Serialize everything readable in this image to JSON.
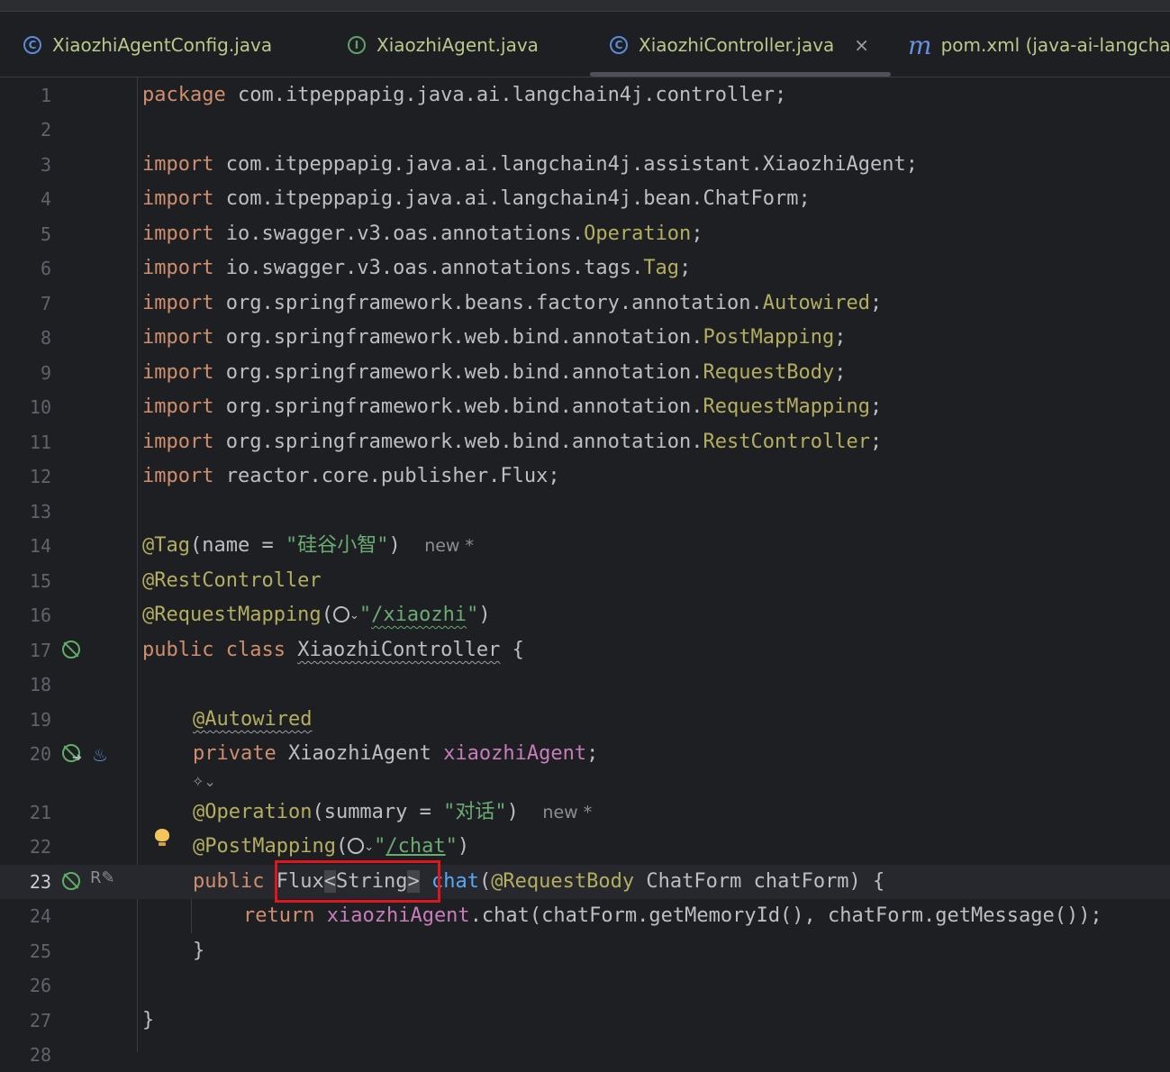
{
  "tabs": [
    {
      "icon": "class-icon",
      "label": "XiaozhiAgentConfig.java"
    },
    {
      "icon": "interface-icon",
      "label": "XiaozhiAgent.java"
    },
    {
      "icon": "class-icon",
      "label": "XiaozhiController.java",
      "active": true,
      "close": "×"
    },
    {
      "icon": "maven-icon",
      "label": "pom.xml (java-ai-langcha"
    }
  ],
  "gutter": {
    "line_numbers": [
      "1",
      "2",
      "3",
      "4",
      "5",
      "6",
      "7",
      "8",
      "9",
      "10",
      "11",
      "12",
      "13",
      "14",
      "15",
      "16",
      "17",
      "18",
      "19",
      "20",
      "21",
      "22",
      "23",
      "24",
      "25",
      "26",
      "27",
      "28"
    ],
    "current_line": "23"
  },
  "code": {
    "l1": {
      "kw": "package",
      "rest": " com.itpeppapig.java.ai.langchain4j.controller;"
    },
    "l3": {
      "kw": "import",
      "rest": " com.itpeppapig.java.ai.langchain4j.assistant.XiaozhiAgent;"
    },
    "l4": {
      "kw": "import",
      "rest": " com.itpeppapig.java.ai.langchain4j.bean.ChatForm;"
    },
    "l5": {
      "kw": "import",
      "pre": " io.swagger.v3.oas.annotations.",
      "ann": "Operation",
      "end": ";"
    },
    "l6": {
      "kw": "import",
      "pre": " io.swagger.v3.oas.annotations.tags.",
      "ann": "Tag",
      "end": ";"
    },
    "l7": {
      "kw": "import",
      "pre": " org.springframework.beans.factory.annotation.",
      "ann": "Autowired",
      "end": ";"
    },
    "l8": {
      "kw": "import",
      "pre": " org.springframework.web.bind.annotation.",
      "ann": "PostMapping",
      "end": ";"
    },
    "l9": {
      "kw": "import",
      "pre": " org.springframework.web.bind.annotation.",
      "ann": "RequestBody",
      "end": ";"
    },
    "l10": {
      "kw": "import",
      "pre": " org.springframework.web.bind.annotation.",
      "ann": "RequestMapping",
      "end": ";"
    },
    "l11": {
      "kw": "import",
      "pre": " org.springframework.web.bind.annotation.",
      "ann": "RestController",
      "end": ";"
    },
    "l12": {
      "kw": "import",
      "rest": " reactor.core.publisher.Flux;"
    },
    "l14": {
      "ann": "@Tag",
      "mid": "(name = ",
      "str": "\"硅谷小智\"",
      "end": ")",
      "hint": "new *"
    },
    "l15": {
      "ann": "@RestController"
    },
    "l16": {
      "ann": "@RequestMapping",
      "open": "(",
      "q1": "\"",
      "path": "/xiaozhi",
      "q2": "\"",
      "close": ")"
    },
    "l17": {
      "kw1": "public",
      "kw2": "class",
      "name": "XiaozhiController",
      "end": " {"
    },
    "l19": {
      "ann": "@Autowired"
    },
    "l20": {
      "kw": "private",
      "type": " XiaozhiAgent ",
      "field": "xiaozhiAgent",
      "end": ";"
    },
    "l21": {
      "ann": "@Operation",
      "mid": "(summary = ",
      "str": "\"对话\"",
      "end": ")",
      "hint": "new *"
    },
    "l22": {
      "ann": "@PostMapping",
      "open": "(",
      "q1": "\"",
      "path": "/chat",
      "q2": "\"",
      "close": ")"
    },
    "l23": {
      "kw": "public",
      "type": "Flux",
      "lt": "<",
      "inner": "String",
      "gt": ">",
      "fn": "chat",
      "p1": "(",
      "ann": "@RequestBody",
      "params": " ChatForm chatForm) {"
    },
    "l24": {
      "kw": "return",
      "field": "xiaozhiAgent",
      "rest": ".chat(chatForm.getMemoryId(), chatForm.getMessage());"
    },
    "l25": {
      "text": "}"
    },
    "l27": {
      "text": "}"
    }
  },
  "colors": {
    "background": "#1e1f22",
    "keyword": "#cf8e6d",
    "annotation": "#b3ae60",
    "string": "#6aab73",
    "field": "#c77dbb",
    "method": "#56a8f5",
    "highlight_box": "#e0161f"
  },
  "gutter_icons": [
    "no-bean-icon",
    "navigate-bean-icon",
    "java-icon",
    "ai-assistant-icon",
    "web-endpoint-icon",
    "reviewer-icon",
    "intention-bulb-icon"
  ]
}
